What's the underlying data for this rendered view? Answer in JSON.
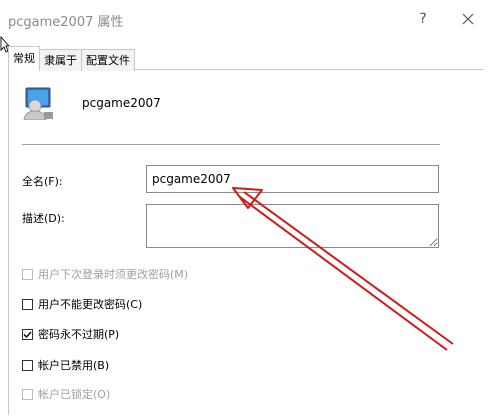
{
  "window": {
    "title": "pcgame2007 属性",
    "help_label": "?"
  },
  "tabs": [
    {
      "label": "常规",
      "active": true
    },
    {
      "label": "隶属于",
      "active": false
    },
    {
      "label": "配置文件",
      "active": false
    }
  ],
  "user": {
    "name": "pcgame2007",
    "icon": "user-icon"
  },
  "fields": {
    "fullname_label": "全名(F):",
    "fullname_value": "pcgame2007",
    "description_label": "描述(D):",
    "description_value": ""
  },
  "checkboxes": [
    {
      "label": "用户下次登录时须更改密码(M)",
      "checked": false,
      "enabled": false
    },
    {
      "label": "用户不能更改密码(C)",
      "checked": false,
      "enabled": true
    },
    {
      "label": "密码永不过期(P)",
      "checked": true,
      "enabled": true
    },
    {
      "label": "帐户已禁用(B)",
      "checked": false,
      "enabled": true
    },
    {
      "label": "帐户已锁定(O)",
      "checked": false,
      "enabled": false
    }
  ],
  "annotation": {
    "color": "#d11a1a"
  }
}
